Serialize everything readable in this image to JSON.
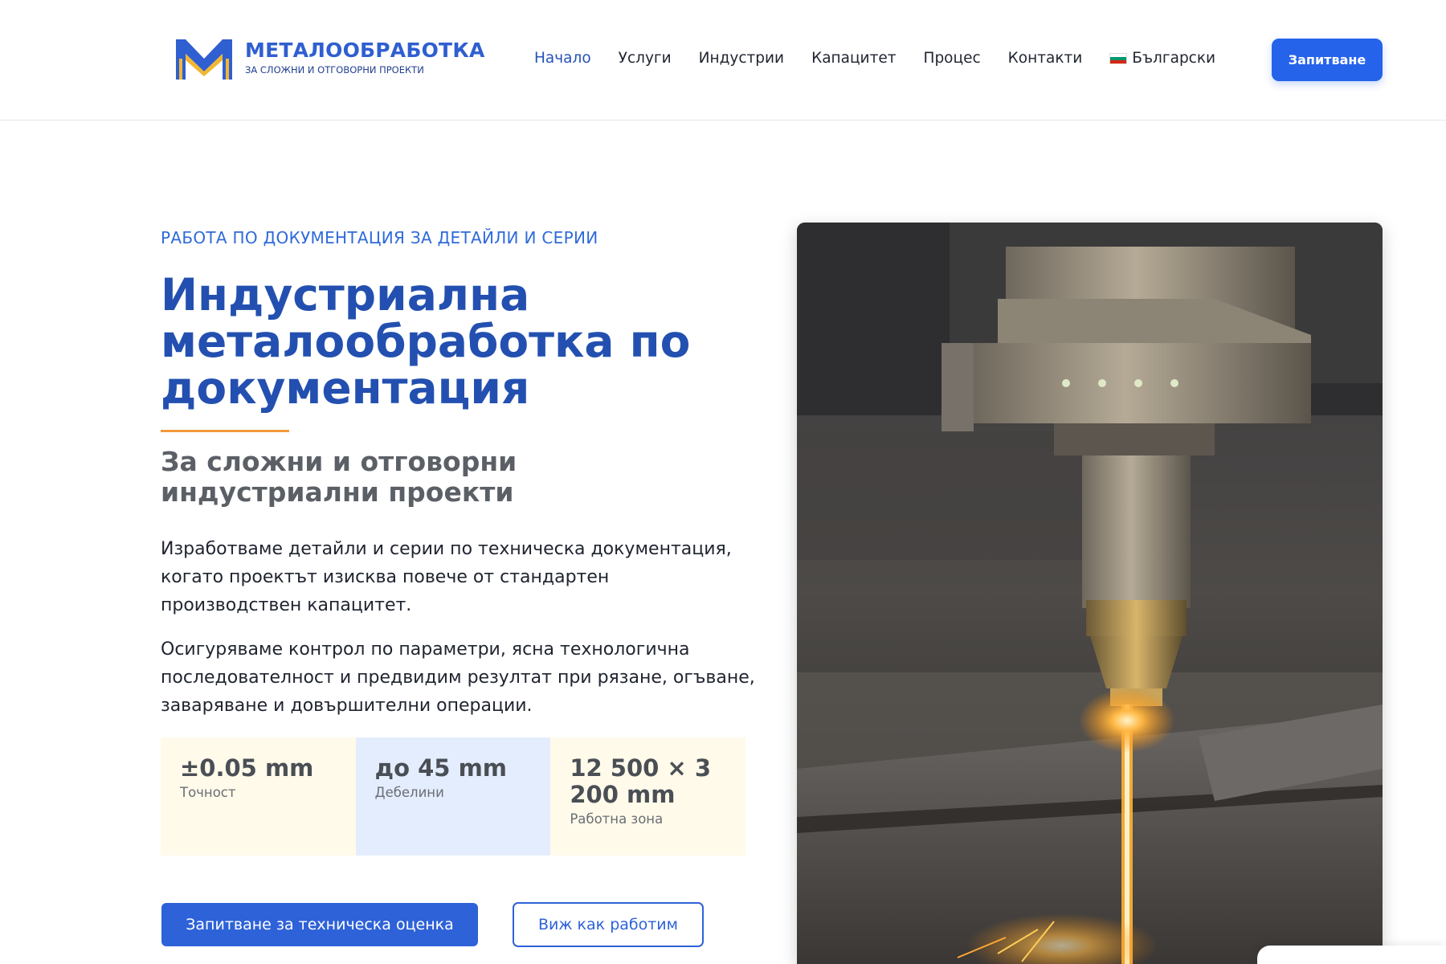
{
  "brand": {
    "title": "МЕТАЛООБРАБОТКА",
    "subtitle": "ЗА СЛОЖНИ И ОТГОВОРНИ ПРОЕКТИ",
    "accent_color": "#2f5fd0"
  },
  "nav": {
    "items": [
      {
        "label": "Начало",
        "active": true
      },
      {
        "label": "Услуги",
        "active": false
      },
      {
        "label": "Индустрии",
        "active": false
      },
      {
        "label": "Капацитет",
        "active": false
      },
      {
        "label": "Процес",
        "active": false
      },
      {
        "label": "Контакти",
        "active": false
      }
    ],
    "language": {
      "label": "Български",
      "icon": "bulgaria-flag-icon"
    },
    "cta_label": "Запитване"
  },
  "hero": {
    "eyebrow": "РАБОТА ПО ДОКУМЕНТАЦИЯ ЗА ДЕТАЙЛИ И СЕРИИ",
    "headline": "Индустриална металообработка по документация",
    "subheadline": "За сложни и отговорни индустриални проекти",
    "paragraph1": "Изработваме детайли и серии по техническа документация, когато проектът изисква повече от стандартен производствен капацитет.",
    "paragraph2": "Осигуряваме контрол по параметри, ясна технологична последователност и предвидим резултат при рязане, огъване, заваряване и довършителни операции.",
    "stats": [
      {
        "value": "±0.05 mm",
        "label": "Точност"
      },
      {
        "value": "до 45 mm",
        "label": "Дебелини"
      },
      {
        "value": "12 500 × 3 200 mm",
        "label": "Работна зона"
      }
    ],
    "primary_button": "Запитване за техническа оценка",
    "secondary_button": "Виж как работим",
    "image": {
      "subject": "laser-cutting-head-icon"
    }
  },
  "colors": {
    "primary": "#2e62d8",
    "heading": "#2350b0",
    "accent_line": "#f29a3a",
    "stat_yellow": "#fffaea",
    "stat_blue": "#e4edfd"
  }
}
